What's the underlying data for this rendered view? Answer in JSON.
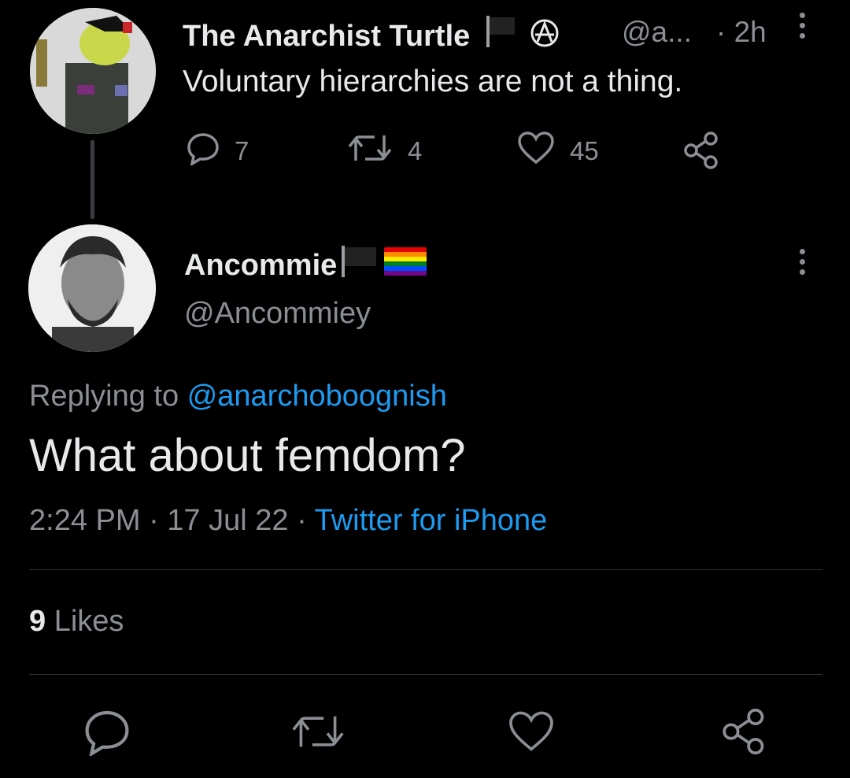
{
  "parent_tweet": {
    "author_name": "The Anarchist Turtle",
    "handle": "@a...",
    "separator_time": "· 2h",
    "text": "Voluntary hierarchies are not a thing.",
    "stats": {
      "replies": "7",
      "retweets": "4",
      "likes": "45"
    }
  },
  "reply_tweet": {
    "author_name": "Ancommie",
    "handle": "@Ancommiey",
    "replying_prefix": "Replying to",
    "replying_to": "@anarchoboognish",
    "text": "What about femdom?",
    "time": "2:24 PM · 17 Jul 22 ·",
    "source": "Twitter for iPhone",
    "likes_count": "9",
    "likes_label": "Likes"
  },
  "icons": {
    "reply": "reply-icon",
    "retweet": "retweet-icon",
    "like": "heart-icon",
    "share": "share-icon",
    "more": "more-icon"
  },
  "colors": {
    "background": "#000000",
    "text": "#e7e9ea",
    "muted": "#8b8f94",
    "link": "#1d9bf0"
  }
}
